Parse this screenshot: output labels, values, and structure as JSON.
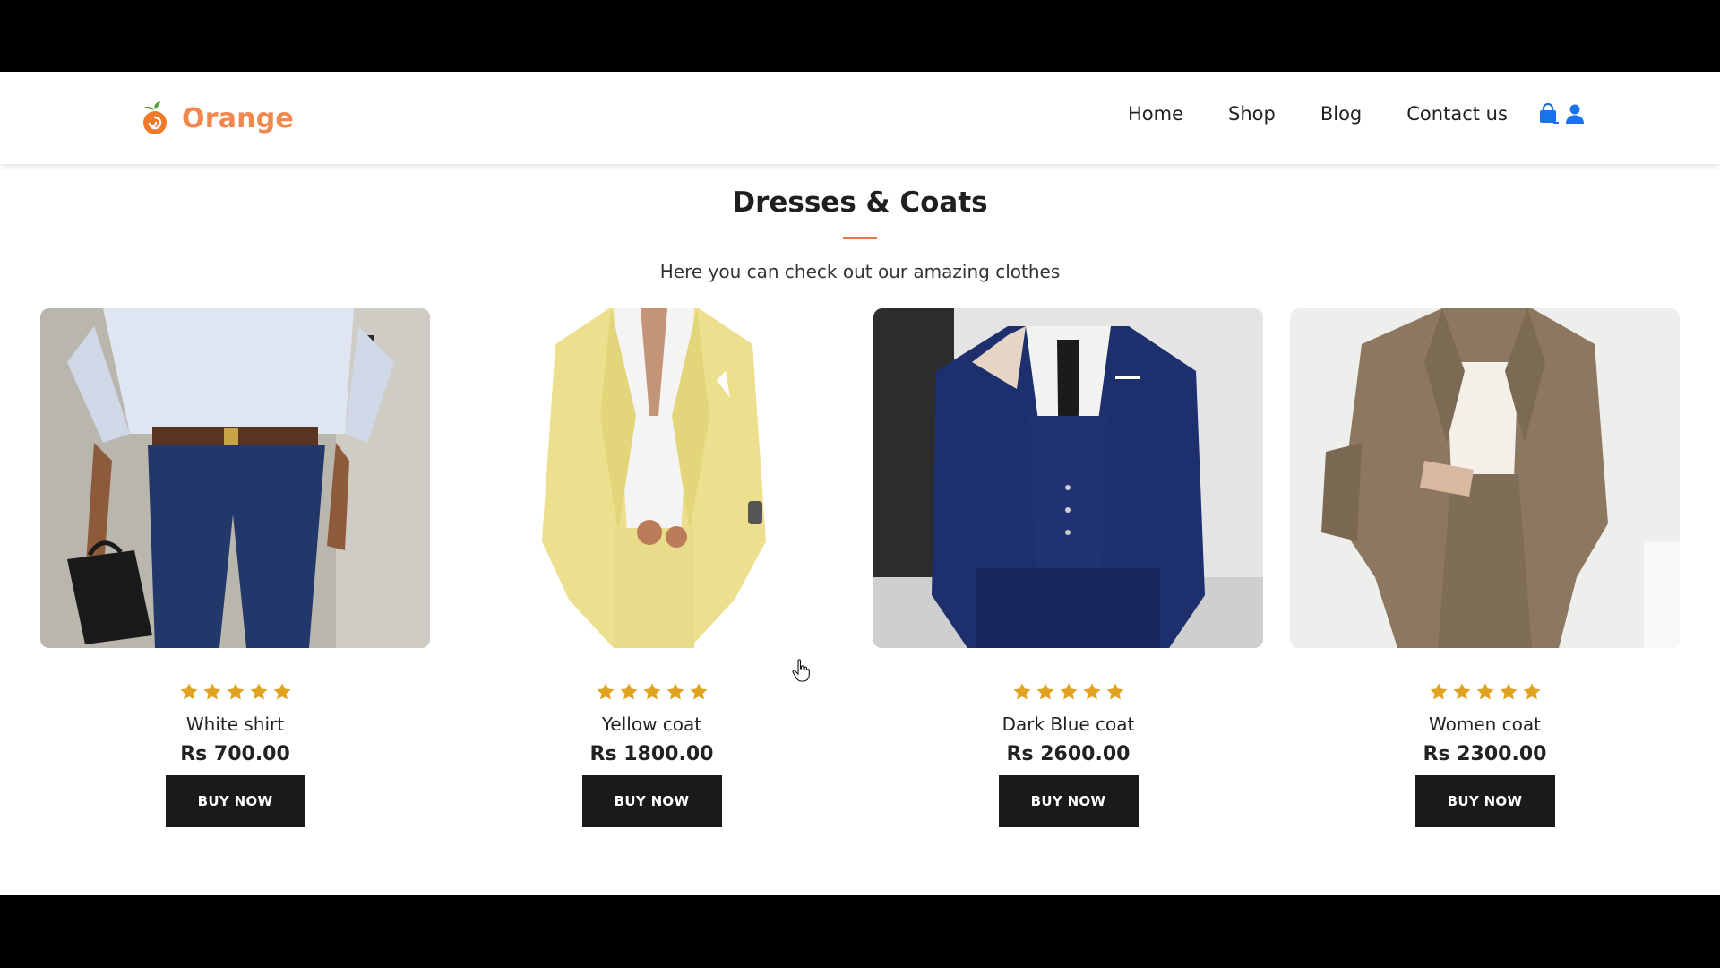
{
  "brand": {
    "name": "Orange",
    "color": "#f0884d"
  },
  "nav": {
    "items": [
      "Home",
      "Shop",
      "Blog",
      "Contact us"
    ],
    "icons": [
      "shopping-bag-icon",
      "user-icon"
    ],
    "icon_color": "#1a73e8"
  },
  "section": {
    "title": "Dresses & Coats",
    "subtitle": "Here you can check out our amazing clothes",
    "accent": "#e07a45"
  },
  "products": [
    {
      "name": "White shirt",
      "price": "Rs 700.00",
      "rating": 5,
      "button": "BUY NOW"
    },
    {
      "name": "Yellow coat",
      "price": "Rs 1800.00",
      "rating": 5,
      "button": "BUY NOW"
    },
    {
      "name": "Dark Blue coat",
      "price": "Rs 2600.00",
      "rating": 5,
      "button": "BUY NOW"
    },
    {
      "name": "Women coat",
      "price": "Rs 2300.00",
      "rating": 5,
      "button": "BUY NOW"
    }
  ],
  "colors": {
    "star": "#e0a21f",
    "button_bg": "#1a1a1a"
  }
}
